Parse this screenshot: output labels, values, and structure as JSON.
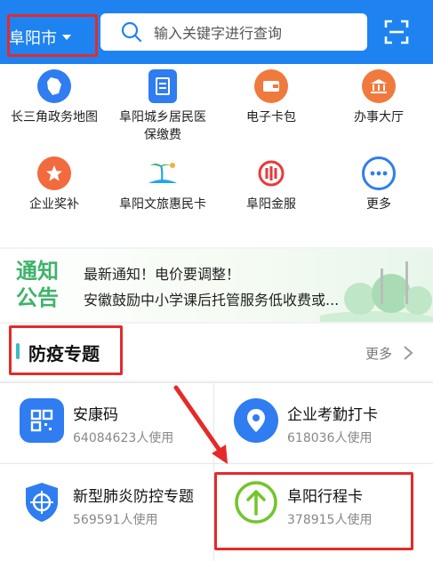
{
  "header": {
    "city": "阜阳市",
    "search_placeholder": "输入关键字进行查询"
  },
  "services": [
    {
      "label": "长三角政务地图",
      "icon": "map-region-icon",
      "color": "#2f7df0"
    },
    {
      "label": "阜阳城乡居民医保缴费",
      "icon": "insurance-bill-icon",
      "color": "#2f7df0"
    },
    {
      "label": "电子卡包",
      "icon": "wallet-icon",
      "color": "#f07a3e"
    },
    {
      "label": "办事大厅",
      "icon": "government-hall-icon",
      "color": "#f07a3e"
    },
    {
      "label": "企业奖补",
      "icon": "star-award-icon",
      "color": "#f26a3d"
    },
    {
      "label": "阜阳文旅惠民卡",
      "icon": "palm-travel-icon",
      "color": "#25a5e8"
    },
    {
      "label": "阜阳金服",
      "icon": "finance-logo-icon",
      "color": "#e83a3a"
    },
    {
      "label": "更多",
      "icon": "more-dots-icon",
      "color": "#2f7df0"
    }
  ],
  "notice": {
    "tag": "通知公告",
    "lines": [
      "最新通知！电价要调整！",
      "安徽鼓励中小学课后托管服务低收费或..."
    ]
  },
  "section": {
    "title": "防疫专题",
    "more": "更多"
  },
  "cards": [
    {
      "title": "安康码",
      "usage": "64084623人使用",
      "icon": "qr-code-icon",
      "color": "#2f7df0"
    },
    {
      "title": "企业考勤打卡",
      "usage": "618036人使用",
      "icon": "location-pin-icon",
      "color": "#2f7df0"
    },
    {
      "title": "新型肺炎防控专题",
      "usage": "569591人使用",
      "icon": "shield-target-icon",
      "color": "#2f7df0"
    },
    {
      "title": "阜阳行程卡",
      "usage": "378915人使用",
      "icon": "up-arrow-circle-icon",
      "color": "#72c52a"
    }
  ]
}
